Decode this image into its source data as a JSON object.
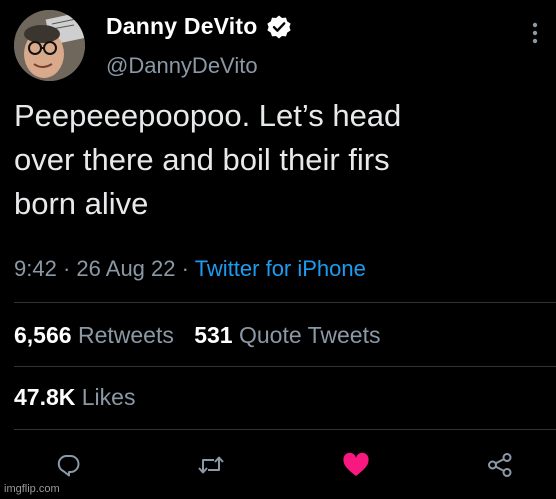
{
  "author": {
    "display_name": "Danny DeVito",
    "handle": "@DannyDeVito",
    "verified": true
  },
  "tweet": {
    "text_lines": [
      "Peepeeepoopoo. Let’s head",
      "over there and boil their firs",
      "born alive"
    ],
    "time": "9:42",
    "separator": "·",
    "date": "26 Aug 22",
    "source": "Twitter for iPhone"
  },
  "stats": {
    "retweets_count": "6,566",
    "retweets_label": "Retweets",
    "quote_count": "531",
    "quote_label": "Quote Tweets",
    "likes_count": "47.8K",
    "likes_label": "Likes"
  },
  "actions": {
    "icons": [
      "reply-icon",
      "retweet-icon",
      "like-icon",
      "share-icon"
    ],
    "like_color": "#f91880"
  },
  "colors": {
    "background": "#000000",
    "text": "#e7e9ea",
    "secondary": "#8b98a5",
    "link": "#1d9bf0"
  },
  "watermark": "imgflip.com"
}
